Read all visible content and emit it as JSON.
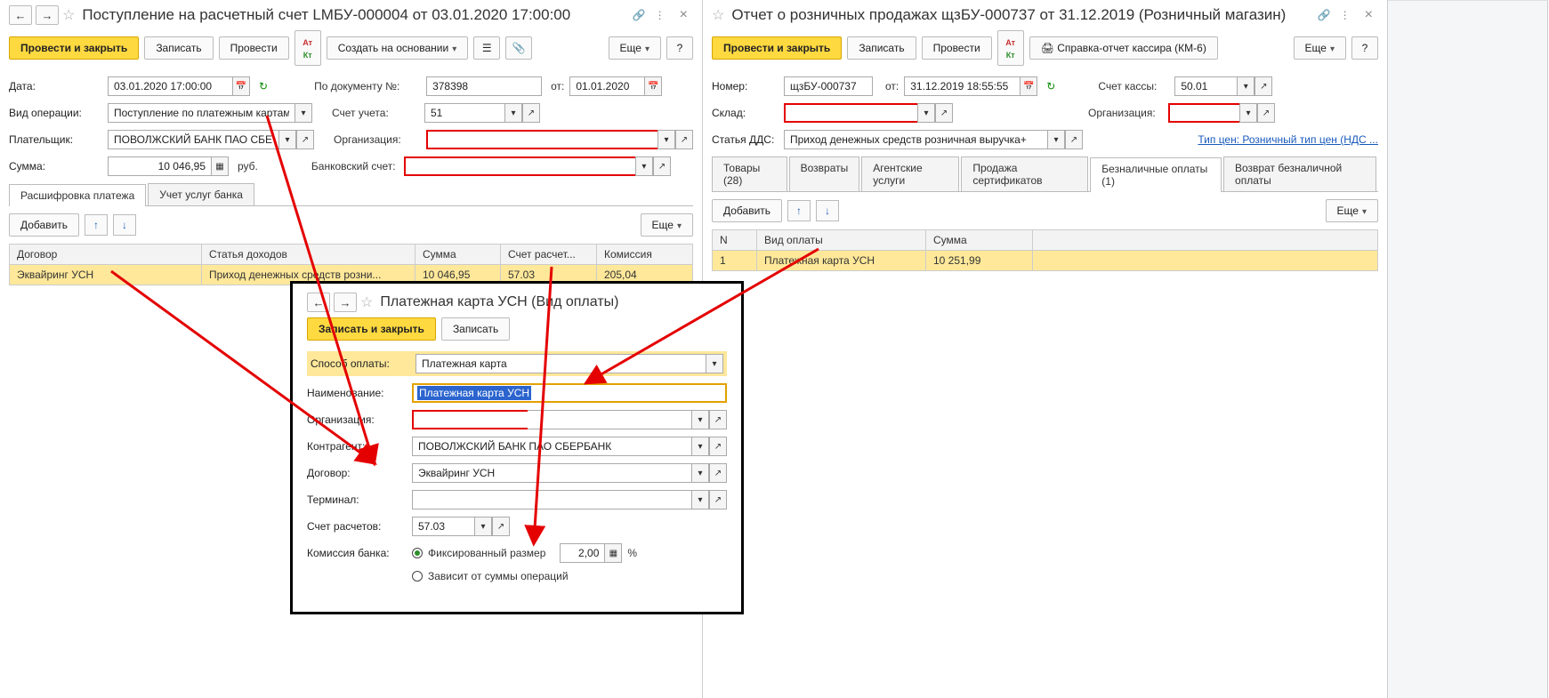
{
  "left": {
    "title": "Поступление на расчетный счет LMБУ-000004 от 03.01.2020 17:00:00",
    "cmd": {
      "post_close": "Провести и закрыть",
      "write": "Записать",
      "post": "Провести",
      "create_based": "Создать на основании",
      "more": "Еще"
    },
    "fields": {
      "date_lbl": "Дата:",
      "date": "03.01.2020 17:00:00",
      "docnum_lbl": "По документу №:",
      "docnum": "378398",
      "docdate_lbl": "от:",
      "docdate": "01.01.2020",
      "op_lbl": "Вид операции:",
      "op": "Поступление по платежным картам",
      "acc_lbl": "Счет учета:",
      "acc": "51",
      "payer_lbl": "Плательщик:",
      "payer": "ПОВОЛЖСКИЙ БАНК ПАО СБЕРБА",
      "org_lbl": "Организация:",
      "sum_lbl": "Сумма:",
      "sum": "10 046,95",
      "curr": "руб.",
      "bank_lbl": "Банковский счет:"
    },
    "tabs": {
      "t1": "Расшифровка платежа",
      "t2": "Учет услуг банка"
    },
    "add": "Добавить",
    "more2": "Еще",
    "cols": {
      "c1": "Договор",
      "c2": "Статья доходов",
      "c3": "Сумма",
      "c4": "Счет расчет...",
      "c5": "Комиссия"
    },
    "row": {
      "c1": "Эквайринг УСН",
      "c2": "Приход денежных средств розни...",
      "c3": "10 046,95",
      "c4": "57.03",
      "c5": "205,04"
    }
  },
  "right": {
    "title": "Отчет о розничных продажах щзБУ-000737 от 31.12.2019 (Розничный магазин)",
    "cmd": {
      "post_close": "Провести и закрыть",
      "write": "Записать",
      "post": "Провести",
      "report": "Справка-отчет кассира (КМ-6)",
      "more": "Еще"
    },
    "fields": {
      "num_lbl": "Номер:",
      "num": "щзБУ-000737",
      "date_lbl": "от:",
      "date": "31.12.2019 18:55:55",
      "cash_lbl": "Счет кассы:",
      "cash": "50.01",
      "wh_lbl": "Склад:",
      "org_lbl": "Организация:",
      "dds_lbl": "Статья ДДС:",
      "dds": "Приход денежных средств розничная выручка+",
      "price_link": "Тип цен: Розничный тип цен (НДС ..."
    },
    "tabs": {
      "t1": "Товары (28)",
      "t2": "Возвраты",
      "t3": "Агентские услуги",
      "t4": "Продажа сертификатов",
      "t5": "Безналичные оплаты (1)",
      "t6": "Возврат безналичной оплаты"
    },
    "add": "Добавить",
    "more2": "Еще",
    "cols": {
      "c1": "N",
      "c2": "Вид оплаты",
      "c3": "Сумма"
    },
    "row": {
      "c1": "1",
      "c2": "Платежная карта УСН",
      "c3": "10 251,99"
    }
  },
  "modal": {
    "title": "Платежная карта УСН (Вид оплаты)",
    "write_close": "Записать и закрыть",
    "write": "Записать",
    "f": {
      "method_lbl": "Способ оплаты:",
      "method": "Платежная карта",
      "name_lbl": "Наименование:",
      "name": "Платежная карта УСН",
      "org_lbl": "Организация:",
      "cagent_lbl": "Контрагент:",
      "cagent": "ПОВОЛЖСКИЙ БАНК ПАО СБЕРБАНК",
      "contract_lbl": "Договор:",
      "contract": "Эквайринг УСН",
      "term_lbl": "Терминал:",
      "acc_lbl": "Счет расчетов:",
      "acc": "57.03",
      "comm_lbl": "Комиссия банка:",
      "comm_fixed": "Фиксированный размер",
      "comm_val": "2,00",
      "pct": "%",
      "comm_var": "Зависит от суммы операций"
    }
  }
}
